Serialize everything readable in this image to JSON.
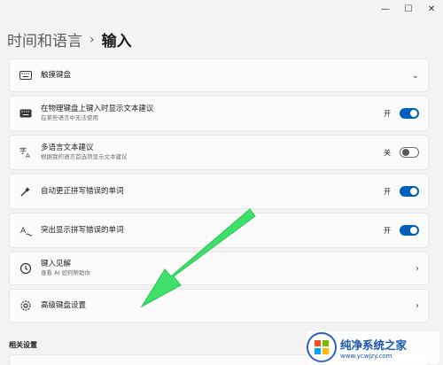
{
  "window_controls": {
    "minimize": "—",
    "maximize": "☐",
    "close": "✕"
  },
  "breadcrumb": {
    "parent": "时间和语言",
    "separator": "›",
    "current": "输入"
  },
  "cards": [
    {
      "id": "touch-keyboard",
      "title": "触摸键盘",
      "subtitle": "",
      "control": "chevron-down",
      "state": "",
      "icon": "keyboard-icon"
    },
    {
      "id": "physical-suggest",
      "title": "在物理键盘上键入时显示文本建议",
      "subtitle": "在某些语言中无法使用",
      "control": "toggle",
      "state": "开",
      "on": true,
      "icon": "keyboard-icon"
    },
    {
      "id": "multilang",
      "title": "多语言文本建议",
      "subtitle": "根据我的语言首选项显示文本建议",
      "control": "toggle",
      "state": "关",
      "on": false,
      "icon": "language-icon"
    },
    {
      "id": "autocorrect",
      "title": "自动更正拼写错误的单词",
      "subtitle": "",
      "control": "toggle",
      "state": "开",
      "on": true,
      "icon": "spell-icon"
    },
    {
      "id": "highlight",
      "title": "突出显示拼写错误的单词",
      "subtitle": "",
      "control": "toggle",
      "state": "开",
      "on": true,
      "icon": "highlight-icon"
    },
    {
      "id": "insights",
      "title": "键入见解",
      "subtitle": "查看 AI 如何帮助你",
      "control": "chevron-right",
      "state": "",
      "icon": "history-icon"
    },
    {
      "id": "advanced",
      "title": "高级键盘设置",
      "subtitle": "",
      "control": "chevron-right",
      "state": "",
      "icon": "gear-icon"
    }
  ],
  "related": {
    "title": "相关设置"
  },
  "watermark": {
    "main": "纯净系统之家",
    "sub": "www.ycwjzy.com"
  },
  "colors": {
    "accent": "#005fb8",
    "arrow": "#3ee06a",
    "background": "#f3f3f3",
    "card": "#fbfbfb"
  }
}
